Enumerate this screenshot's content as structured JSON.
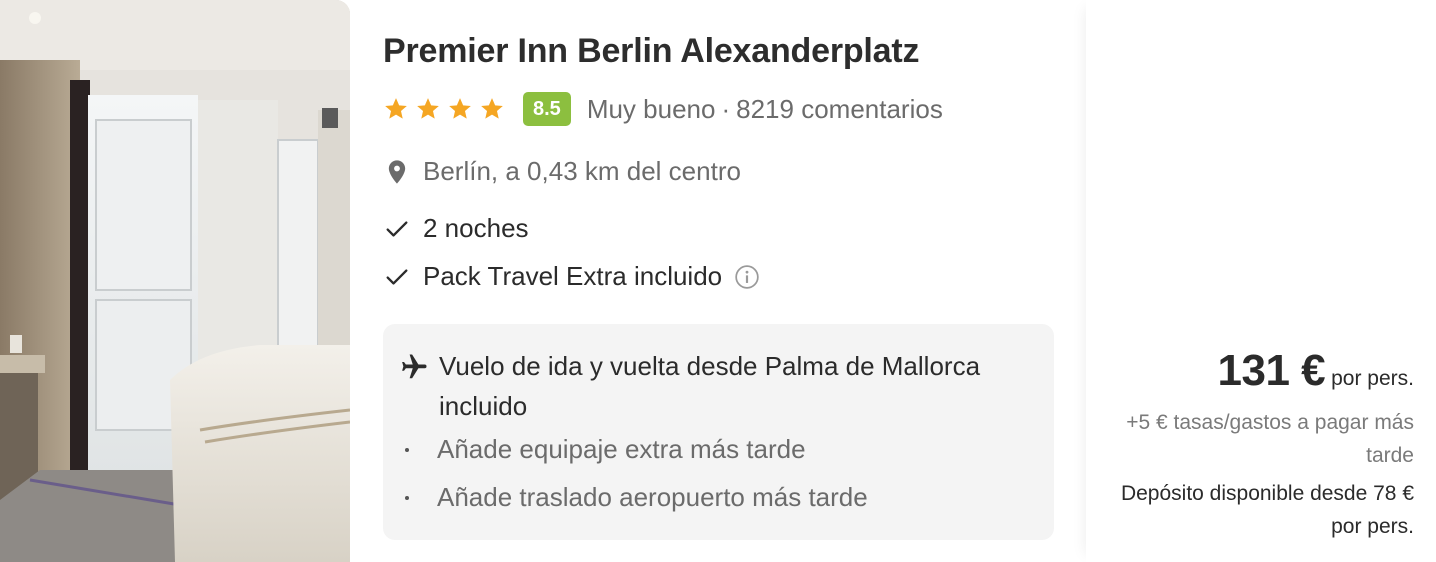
{
  "hotel": {
    "name": "Premier Inn Berlin Alexanderplatz",
    "stars": 4,
    "score": "8.5",
    "rating_label": "Muy bueno",
    "separator": "·",
    "reviews": "8219 comentarios",
    "location": "Berlín, a 0,43 km del centro"
  },
  "features": {
    "nights": "2 noches",
    "pack": "Pack Travel Extra incluido"
  },
  "flight": {
    "text": "Vuelo de ida y vuelta desde Palma de Mallorca incluido",
    "extras": [
      "Añade equipaje extra más tarde",
      "Añade traslado aeropuerto más tarde"
    ]
  },
  "price": {
    "amount": "131 €",
    "unit": "por pers.",
    "taxes": "+5 € tasas/gastos a pagar más tarde",
    "deposit": "Depósito disponible desde 78 € por pers."
  },
  "colors": {
    "score_badge": "#8cbf3f",
    "star": "#f5a623",
    "muted_text": "#6b6b6b"
  },
  "icons": {
    "star": "star-icon",
    "location": "map-pin-icon",
    "check": "checkmark-icon",
    "info": "info-circle-icon",
    "plane": "airplane-icon"
  }
}
